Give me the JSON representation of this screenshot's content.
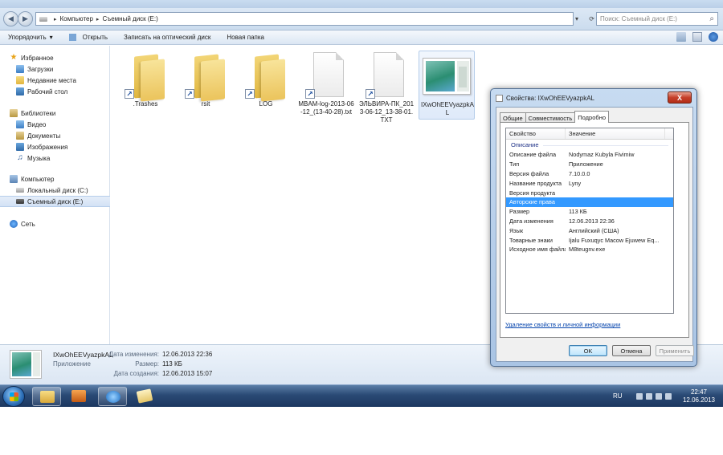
{
  "explorer": {
    "address": {
      "crumbs": [
        "Компьютер",
        "Съемный диск (E:)"
      ],
      "search_placeholder": "Поиск: Съемный диск (E:)"
    },
    "toolbar": {
      "organize": "Упорядочить",
      "open": "Открыть",
      "burn": "Записать на оптический диск",
      "new_folder": "Новая папка"
    },
    "sidebar": {
      "favorites": {
        "label": "Избранное",
        "items": [
          "Загрузки",
          "Недавние места",
          "Рабочий стол"
        ]
      },
      "libraries": {
        "label": "Библиотеки",
        "items": [
          "Видео",
          "Документы",
          "Изображения",
          "Музыка"
        ]
      },
      "computer": {
        "label": "Компьютер",
        "items": [
          "Локальный диск (C:)",
          "Съемный диск (E:)"
        ]
      },
      "network": {
        "label": "Сеть"
      }
    },
    "files": [
      {
        "name": ".Trashes",
        "kind": "folder-shortcut"
      },
      {
        "name": "rsit",
        "kind": "folder-shortcut"
      },
      {
        "name": "LOG",
        "kind": "folder-shortcut"
      },
      {
        "name": "MBAM-log-2013-06-12_(13-40-28).txt",
        "kind": "doc-shortcut"
      },
      {
        "name": "ЭЛЬВИРА-ПК_2013-06-12_13-38-01.TXT",
        "kind": "doc-shortcut"
      },
      {
        "name": "IXwOhEEVyazpkAL",
        "kind": "app",
        "selected": true
      }
    ],
    "details": {
      "name": "IXwOhEEVyazpkAL",
      "type": "Приложение",
      "modified_label": "Дата изменения:",
      "modified_value": "12.06.2013 22:36",
      "size_label": "Размер:",
      "size_value": "113 КБ",
      "created_label": "Дата создания:",
      "created_value": "12.06.2013 15:07"
    }
  },
  "taskbar": {
    "lang": "RU",
    "time": "22:47",
    "date": "12.06.2013"
  },
  "properties_dialog": {
    "title": "Свойства: IXwOhEEVyazpkAL",
    "close": "X",
    "tabs": [
      "Общие",
      "Совместимость",
      "Подробно"
    ],
    "active_tab": "Подробно",
    "columns": [
      "Свойство",
      "Значение"
    ],
    "group": "Описание",
    "rows": [
      {
        "key": "Описание файла",
        "value": "Nodymaz Kubyla Fivimiw"
      },
      {
        "key": "Тип",
        "value": "Приложение"
      },
      {
        "key": "Версия файла",
        "value": "7.10.0.0"
      },
      {
        "key": "Название продукта",
        "value": "Lyny"
      },
      {
        "key": "Версия продукта",
        "value": ""
      },
      {
        "key": "Авторские права",
        "value": "",
        "highlighted": true
      },
      {
        "key": "Размер",
        "value": "113 КБ"
      },
      {
        "key": "Дата изменения",
        "value": "12.06.2013 22:36"
      },
      {
        "key": "Язык",
        "value": "Английский (США)"
      },
      {
        "key": "Товарные знаки",
        "value": "Ijalu Fuxuqyc Macow Ejuwew Eq..."
      },
      {
        "key": "Исходное имя файла",
        "value": "M8teugnv.exe"
      }
    ],
    "remove_link": "Удаление свойств и личной информации",
    "ok": "OK",
    "cancel": "Отмена",
    "apply": "Применить"
  },
  "colors": {
    "selection": "#3399ff",
    "link": "#0645ad",
    "group_header": "#1e3287"
  }
}
